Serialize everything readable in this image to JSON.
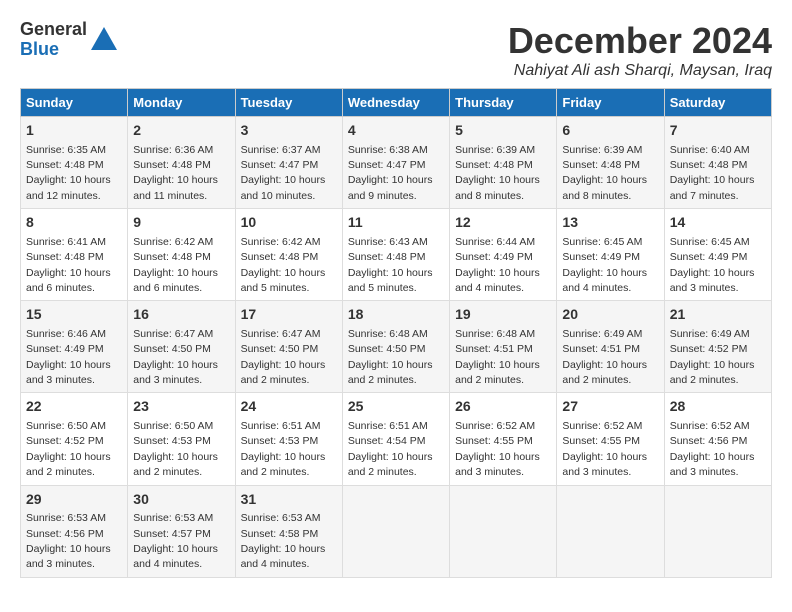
{
  "logo": {
    "general": "General",
    "blue": "Blue"
  },
  "title": "December 2024",
  "subtitle": "Nahiyat Ali ash Sharqi, Maysan, Iraq",
  "days_of_week": [
    "Sunday",
    "Monday",
    "Tuesday",
    "Wednesday",
    "Thursday",
    "Friday",
    "Saturday"
  ],
  "weeks": [
    [
      {
        "day": "1",
        "sunrise": "6:35 AM",
        "sunset": "4:48 PM",
        "daylight": "10 hours and 12 minutes."
      },
      {
        "day": "2",
        "sunrise": "6:36 AM",
        "sunset": "4:48 PM",
        "daylight": "10 hours and 11 minutes."
      },
      {
        "day": "3",
        "sunrise": "6:37 AM",
        "sunset": "4:47 PM",
        "daylight": "10 hours and 10 minutes."
      },
      {
        "day": "4",
        "sunrise": "6:38 AM",
        "sunset": "4:47 PM",
        "daylight": "10 hours and 9 minutes."
      },
      {
        "day": "5",
        "sunrise": "6:39 AM",
        "sunset": "4:48 PM",
        "daylight": "10 hours and 8 minutes."
      },
      {
        "day": "6",
        "sunrise": "6:39 AM",
        "sunset": "4:48 PM",
        "daylight": "10 hours and 8 minutes."
      },
      {
        "day": "7",
        "sunrise": "6:40 AM",
        "sunset": "4:48 PM",
        "daylight": "10 hours and 7 minutes."
      }
    ],
    [
      {
        "day": "8",
        "sunrise": "6:41 AM",
        "sunset": "4:48 PM",
        "daylight": "10 hours and 6 minutes."
      },
      {
        "day": "9",
        "sunrise": "6:42 AM",
        "sunset": "4:48 PM",
        "daylight": "10 hours and 6 minutes."
      },
      {
        "day": "10",
        "sunrise": "6:42 AM",
        "sunset": "4:48 PM",
        "daylight": "10 hours and 5 minutes."
      },
      {
        "day": "11",
        "sunrise": "6:43 AM",
        "sunset": "4:48 PM",
        "daylight": "10 hours and 5 minutes."
      },
      {
        "day": "12",
        "sunrise": "6:44 AM",
        "sunset": "4:49 PM",
        "daylight": "10 hours and 4 minutes."
      },
      {
        "day": "13",
        "sunrise": "6:45 AM",
        "sunset": "4:49 PM",
        "daylight": "10 hours and 4 minutes."
      },
      {
        "day": "14",
        "sunrise": "6:45 AM",
        "sunset": "4:49 PM",
        "daylight": "10 hours and 3 minutes."
      }
    ],
    [
      {
        "day": "15",
        "sunrise": "6:46 AM",
        "sunset": "4:49 PM",
        "daylight": "10 hours and 3 minutes."
      },
      {
        "day": "16",
        "sunrise": "6:47 AM",
        "sunset": "4:50 PM",
        "daylight": "10 hours and 3 minutes."
      },
      {
        "day": "17",
        "sunrise": "6:47 AM",
        "sunset": "4:50 PM",
        "daylight": "10 hours and 2 minutes."
      },
      {
        "day": "18",
        "sunrise": "6:48 AM",
        "sunset": "4:50 PM",
        "daylight": "10 hours and 2 minutes."
      },
      {
        "day": "19",
        "sunrise": "6:48 AM",
        "sunset": "4:51 PM",
        "daylight": "10 hours and 2 minutes."
      },
      {
        "day": "20",
        "sunrise": "6:49 AM",
        "sunset": "4:51 PM",
        "daylight": "10 hours and 2 minutes."
      },
      {
        "day": "21",
        "sunrise": "6:49 AM",
        "sunset": "4:52 PM",
        "daylight": "10 hours and 2 minutes."
      }
    ],
    [
      {
        "day": "22",
        "sunrise": "6:50 AM",
        "sunset": "4:52 PM",
        "daylight": "10 hours and 2 minutes."
      },
      {
        "day": "23",
        "sunrise": "6:50 AM",
        "sunset": "4:53 PM",
        "daylight": "10 hours and 2 minutes."
      },
      {
        "day": "24",
        "sunrise": "6:51 AM",
        "sunset": "4:53 PM",
        "daylight": "10 hours and 2 minutes."
      },
      {
        "day": "25",
        "sunrise": "6:51 AM",
        "sunset": "4:54 PM",
        "daylight": "10 hours and 2 minutes."
      },
      {
        "day": "26",
        "sunrise": "6:52 AM",
        "sunset": "4:55 PM",
        "daylight": "10 hours and 3 minutes."
      },
      {
        "day": "27",
        "sunrise": "6:52 AM",
        "sunset": "4:55 PM",
        "daylight": "10 hours and 3 minutes."
      },
      {
        "day": "28",
        "sunrise": "6:52 AM",
        "sunset": "4:56 PM",
        "daylight": "10 hours and 3 minutes."
      }
    ],
    [
      {
        "day": "29",
        "sunrise": "6:53 AM",
        "sunset": "4:56 PM",
        "daylight": "10 hours and 3 minutes."
      },
      {
        "day": "30",
        "sunrise": "6:53 AM",
        "sunset": "4:57 PM",
        "daylight": "10 hours and 4 minutes."
      },
      {
        "day": "31",
        "sunrise": "6:53 AM",
        "sunset": "4:58 PM",
        "daylight": "10 hours and 4 minutes."
      },
      null,
      null,
      null,
      null
    ]
  ]
}
